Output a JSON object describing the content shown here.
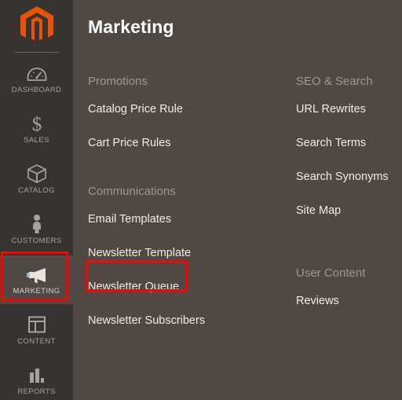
{
  "sidebar": {
    "logo": {
      "name": "magento-logo",
      "color": "#eb5202"
    },
    "items": [
      {
        "label": "DASHBOARD",
        "icon": "gauge-icon",
        "active": false
      },
      {
        "label": "SALES",
        "icon": "dollar-icon",
        "active": false
      },
      {
        "label": "CATALOG",
        "icon": "box-icon",
        "active": false
      },
      {
        "label": "CUSTOMERS",
        "icon": "person-icon",
        "active": false
      },
      {
        "label": "MARKETING",
        "icon": "megaphone-icon",
        "active": true
      },
      {
        "label": "CONTENT",
        "icon": "layout-icon",
        "active": false
      },
      {
        "label": "REPORTS",
        "icon": "bar-chart-icon",
        "active": false
      }
    ]
  },
  "main": {
    "title": "Marketing",
    "columns": {
      "left": [
        {
          "heading": "Promotions",
          "links": [
            "Catalog Price Rule",
            "Cart Price Rules"
          ]
        },
        {
          "heading": "Communications",
          "links": [
            "Email Templates",
            "Newsletter Template",
            "Newsletter Queue",
            "Newsletter Subscribers"
          ]
        }
      ],
      "right": [
        {
          "heading": "SEO & Search",
          "links": [
            "URL Rewrites",
            "Search Terms",
            "Search Synonyms",
            "Site Map"
          ]
        },
        {
          "heading": "User Content",
          "links": [
            "Reviews"
          ]
        }
      ]
    }
  },
  "highlights": {
    "color": "#ff0000",
    "targets": [
      "MARKETING",
      "Email Templates"
    ]
  },
  "colors": {
    "sidebar_bg": "#373330",
    "main_bg": "#4f4843",
    "accent": "#eb5202",
    "link_text": "#f0ece8",
    "heading_text": "#a09791"
  }
}
